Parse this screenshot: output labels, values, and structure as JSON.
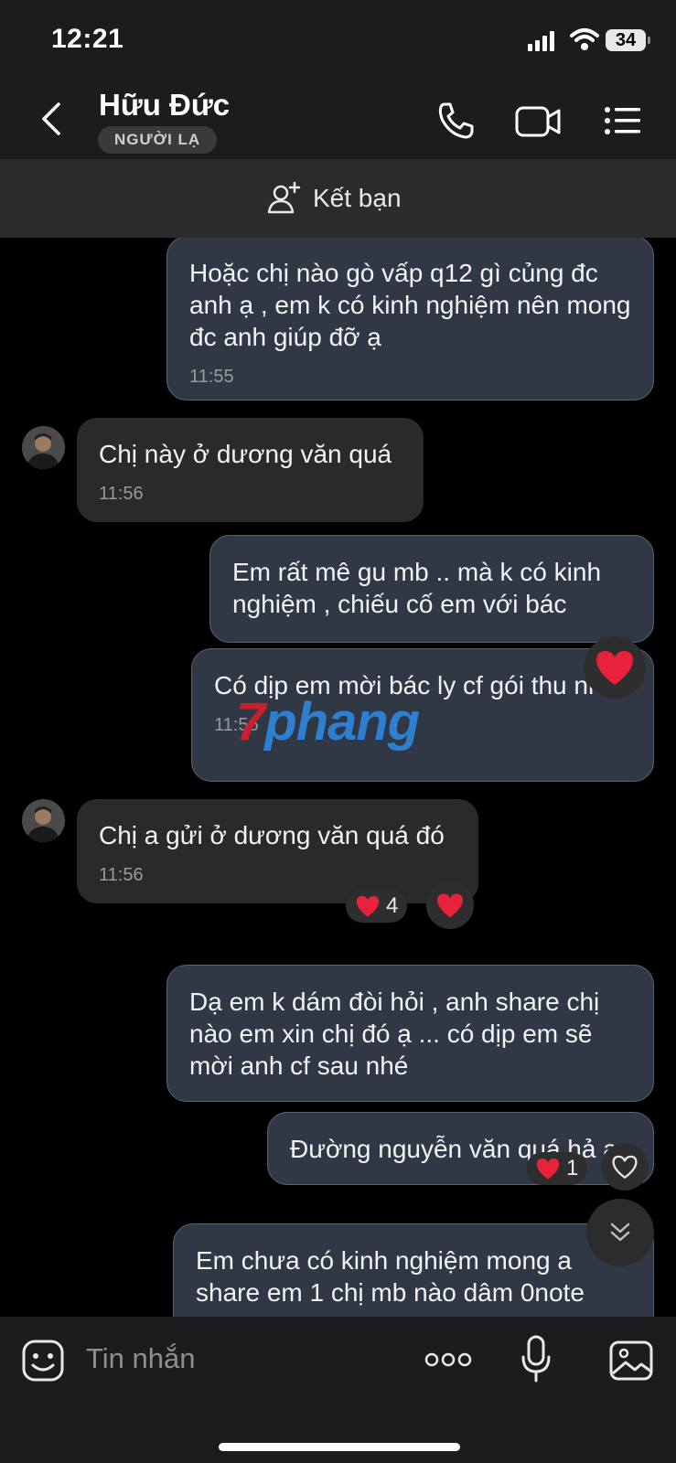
{
  "status_bar": {
    "time": "12:21",
    "battery": "34"
  },
  "header": {
    "contact_name": "Hữu Đức",
    "badge": "NGƯỜI LẠ"
  },
  "friend_bar": {
    "label": "Kết bạn"
  },
  "messages": [
    {
      "text": "Hoặc chị nào gò vấp q12 gì củng đc anh ạ , em k có kinh nghiệm nên mong đc anh giúp đỡ ạ",
      "time": "11:55"
    },
    {
      "text": "Chị này ở dương văn quá",
      "time": "11:56"
    },
    {
      "text": "Em rất mê gu mb .. mà k có kinh nghiệm , chiếu cố em với bác"
    },
    {
      "text": "Có dịp em mời bác ly cf gói thu nhé",
      "time": "11:56"
    },
    {
      "text": "Chị a gửi ở dương văn quá đó",
      "time": "11:56",
      "reaction_count": "4"
    },
    {
      "text": "Dạ em k dám đòi hỏi , anh share chị nào em xin chị đó ạ ... có dịp em sẽ mời anh cf sau nhé"
    },
    {
      "text": "Đường nguyễn văn quá hả a",
      "reaction_count": "1"
    },
    {
      "text": "Em chưa có kinh nghiệm mong a share em 1 chị mb nào dâm 0note"
    }
  ],
  "watermark": {
    "part1": "7",
    "part2": "phang"
  },
  "composer": {
    "placeholder": "Tin nhắn"
  },
  "icons": {
    "back": "chevron-left-icon",
    "call": "phone-icon",
    "video": "video-camera-icon",
    "menu": "list-menu-icon",
    "add_friend": "user-plus-icon",
    "sticker": "sticker-icon",
    "more": "more-dots-icon",
    "mic": "microphone-icon",
    "image": "image-icon",
    "scroll_down": "double-chevron-down-icon"
  },
  "colors": {
    "outgoing_bubble": "#303846",
    "incoming_bubble": "#2a2a2c",
    "heart": "#e8223a"
  }
}
